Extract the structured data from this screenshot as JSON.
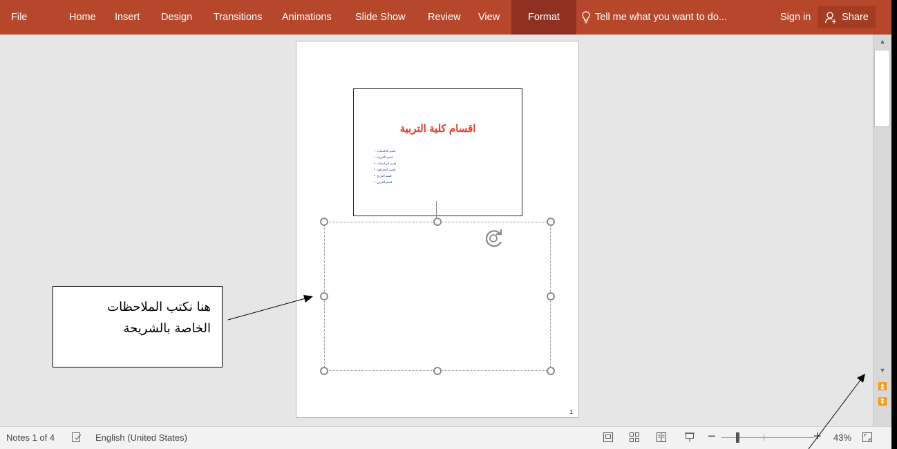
{
  "ribbon": {
    "tabs": [
      {
        "label": "File"
      },
      {
        "label": "Home"
      },
      {
        "label": "Insert"
      },
      {
        "label": "Design"
      },
      {
        "label": "Transitions"
      },
      {
        "label": "Animations"
      },
      {
        "label": "Slide Show"
      },
      {
        "label": "Review"
      },
      {
        "label": "View"
      },
      {
        "label": "Format",
        "active": true
      }
    ],
    "tell_me_placeholder": "Tell me what you want to do...",
    "sign_in": "Sign in",
    "share": "Share",
    "accent_color": "#b7472a"
  },
  "slide": {
    "title": "اقسام كلية التربية",
    "bullets": [
      "قسم الحاسبات",
      "قسم الفيزياء",
      "قسم الرياضيات",
      "قسم الجغرافية",
      "قسم التاريخ",
      "قسم العربي"
    ],
    "title_color": "#e8382a",
    "page_number": "1"
  },
  "callout": {
    "line1": "هنا نكتب الملاحظات",
    "line2": "الخاصة بالشريحة"
  },
  "status": {
    "notes_count": "Notes 1 of 4",
    "language": "English (United States)",
    "zoom_percent": "43%",
    "zoom_level": 0.43
  }
}
